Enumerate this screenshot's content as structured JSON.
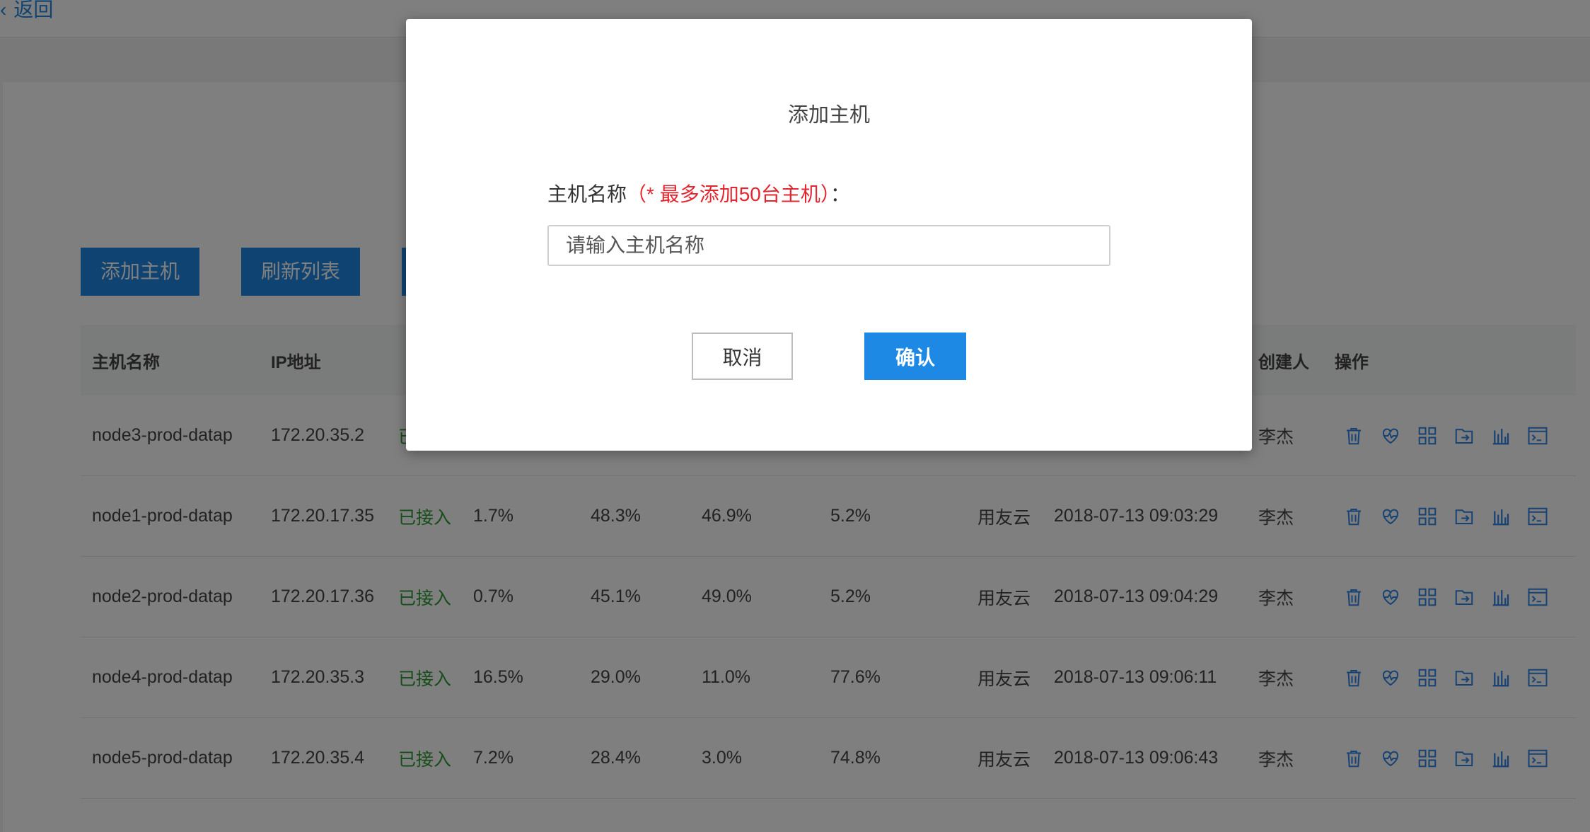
{
  "nav": {
    "back_label": "返回"
  },
  "toolbar": {
    "add_label": "添加主机",
    "refresh_label": "刷新列表"
  },
  "table": {
    "headers": {
      "name": "主机名称",
      "ip": "IP地址",
      "creator": "创建人",
      "actions": "操作"
    },
    "rows": [
      {
        "name": "node3-prod-datap",
        "ip": "172.20.35.2",
        "status": "已接入",
        "cpu": "",
        "mem": "",
        "disk": "",
        "net": "",
        "cloud": "",
        "created": "",
        "creator": "李杰"
      },
      {
        "name": "node1-prod-datap",
        "ip": "172.20.17.35",
        "status": "已接入",
        "cpu": "1.7%",
        "mem": "48.3%",
        "disk": "46.9%",
        "net": "5.2%",
        "cloud": "用友云",
        "created": "2018-07-13 09:03:29",
        "creator": "李杰"
      },
      {
        "name": "node2-prod-datap",
        "ip": "172.20.17.36",
        "status": "已接入",
        "cpu": "0.7%",
        "mem": "45.1%",
        "disk": "49.0%",
        "net": "5.2%",
        "cloud": "用友云",
        "created": "2018-07-13 09:04:29",
        "creator": "李杰"
      },
      {
        "name": "node4-prod-datap",
        "ip": "172.20.35.3",
        "status": "已接入",
        "cpu": "16.5%",
        "mem": "29.0%",
        "disk": "11.0%",
        "net": "77.6%",
        "cloud": "用友云",
        "created": "2018-07-13 09:06:11",
        "creator": "李杰"
      },
      {
        "name": "node5-prod-datap",
        "ip": "172.20.35.4",
        "status": "已接入",
        "cpu": "7.2%",
        "mem": "28.4%",
        "disk": "3.0%",
        "net": "74.8%",
        "cloud": "用友云",
        "created": "2018-07-13 09:06:43",
        "creator": "李杰"
      }
    ],
    "row_actions": [
      "delete-icon",
      "health-heart-icon",
      "grid-apps-icon",
      "export-icon",
      "bar-chart-icon",
      "terminal-icon"
    ]
  },
  "modal": {
    "title": "添加主机",
    "label_main": "主机名称",
    "label_required": "（* 最多添加50台主机）",
    "label_colon": "：",
    "input_value": "",
    "input_placeholder": "请输入主机名称",
    "cancel_label": "取消",
    "confirm_label": "确认"
  },
  "colors": {
    "primary": "#1e88e5",
    "status_ok": "#2e9b35",
    "required": "#e3262f",
    "icon": "#2f86e8"
  }
}
